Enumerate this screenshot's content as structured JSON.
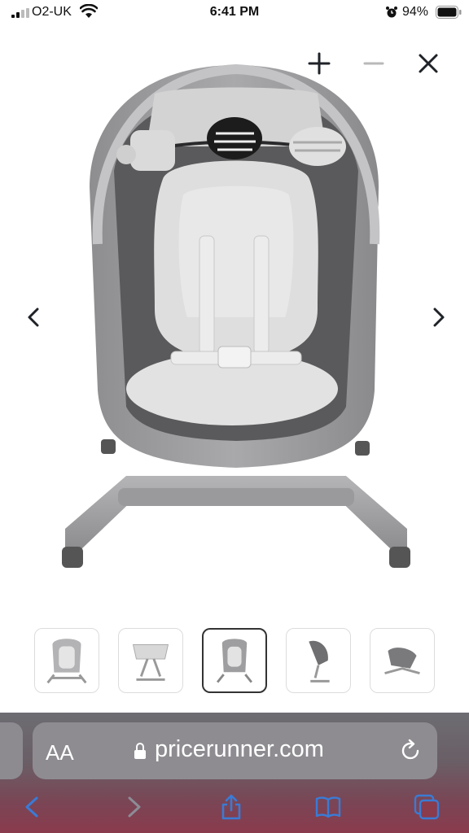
{
  "status": {
    "carrier": "O2-UK",
    "time": "6:41 PM",
    "battery": "94%"
  },
  "viewer": {
    "controls": [
      "zoom-in",
      "zoom-out",
      "close",
      "previous",
      "next"
    ],
    "thumbnail_count": 5,
    "active_thumbnail": 3
  },
  "browser": {
    "text_size_label": "AA",
    "url": "pricerunner.com",
    "toolbar": [
      "back",
      "forward",
      "share",
      "bookmarks",
      "tabs"
    ]
  },
  "colors": {
    "icon_dark": "#1f2328",
    "link_blue": "#3a7bd5",
    "bar_top": "#6d6d72",
    "bar_bottom": "#8a3b4c"
  }
}
